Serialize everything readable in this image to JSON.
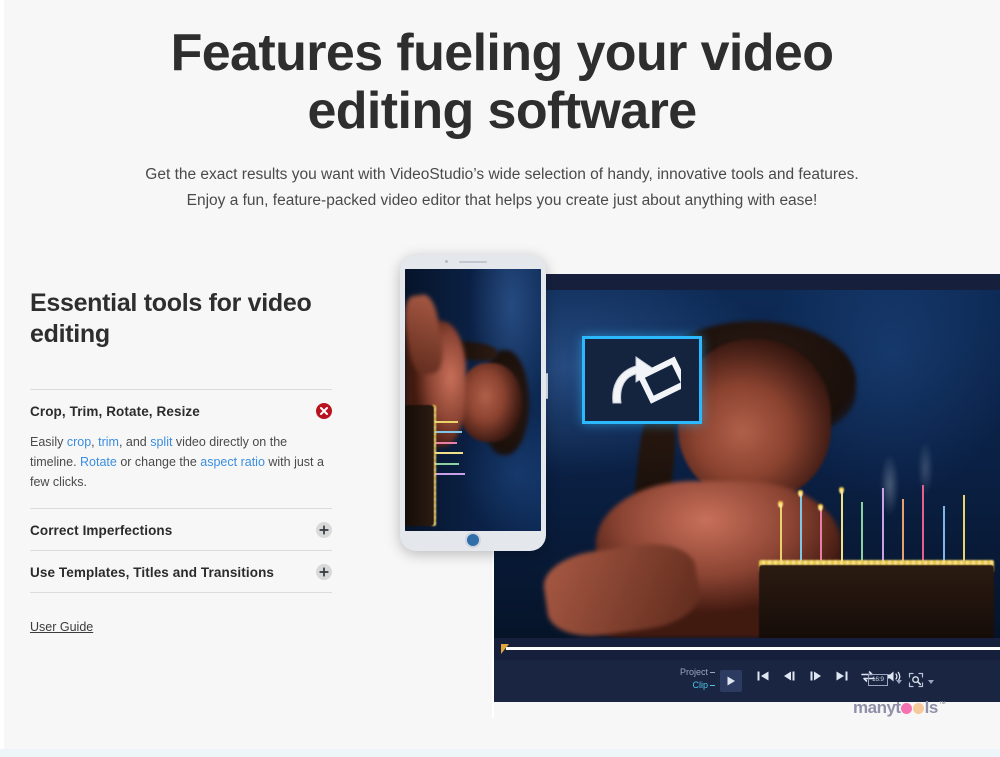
{
  "hero": {
    "title": "Features fueling your video editing software",
    "subtitle_line1": "Get the exact results you want with VideoStudio’s wide selection of handy, innovative tools and features.",
    "subtitle_line2": "Enjoy a fun, feature-packed video editor that helps you create just about anything with ease!"
  },
  "left_panel": {
    "section_title": "Essential tools for video editing",
    "accordion": [
      {
        "title": "Crop, Trim, Rotate, Resize",
        "state": "expanded",
        "icon": "close-circle-icon",
        "body_parts": [
          {
            "text": "Easily ",
            "link": false
          },
          {
            "text": "crop",
            "link": true
          },
          {
            "text": ", ",
            "link": false
          },
          {
            "text": "trim",
            "link": true
          },
          {
            "text": ", and ",
            "link": false
          },
          {
            "text": "split",
            "link": true
          },
          {
            "text": " video directly on the timeline. ",
            "link": false
          },
          {
            "text": "Rotate",
            "link": true
          },
          {
            "text": " or change the ",
            "link": false
          },
          {
            "text": "aspect ratio",
            "link": true
          },
          {
            "text": " with just a few clicks.",
            "link": false
          }
        ]
      },
      {
        "title": "Correct Imperfections",
        "state": "collapsed",
        "icon": "plus-circle-icon",
        "body_parts": []
      },
      {
        "title": "Use Templates, Titles and Transitions",
        "state": "collapsed",
        "icon": "plus-circle-icon",
        "body_parts": []
      }
    ],
    "user_guide_label": "User Guide"
  },
  "media": {
    "alt": "VideoStudio editor showing a rotate tool applied to a birthday video, with a phone mockup displaying the rotated clip",
    "rotate_tool_icon": "rotate-clip-icon",
    "transport": {
      "project_label": "Project",
      "clip_label": "Clip",
      "play_icon": "play-icon",
      "buttons": [
        "skip-to-start-icon",
        "step-back-icon",
        "step-forward-icon",
        "skip-to-end-icon",
        "loop-icon",
        "volume-icon"
      ],
      "aspect_ratio_badge": "16:9",
      "capture_icon": "snapshot-icon"
    }
  },
  "watermark": {
    "prefix": "many",
    "mid": "t",
    "suffix": "ls",
    "tm": "™"
  },
  "colors": {
    "page_bg": "#f7f7f7",
    "heading": "#2e2e2e",
    "link_blue": "#3b8ede",
    "accent_red": "#b81420",
    "accent_cyan": "#2bb8ff",
    "editor_dark": "#0d1a33",
    "watermark_pink": "#f573b0",
    "watermark_peach": "#f6c99a"
  }
}
